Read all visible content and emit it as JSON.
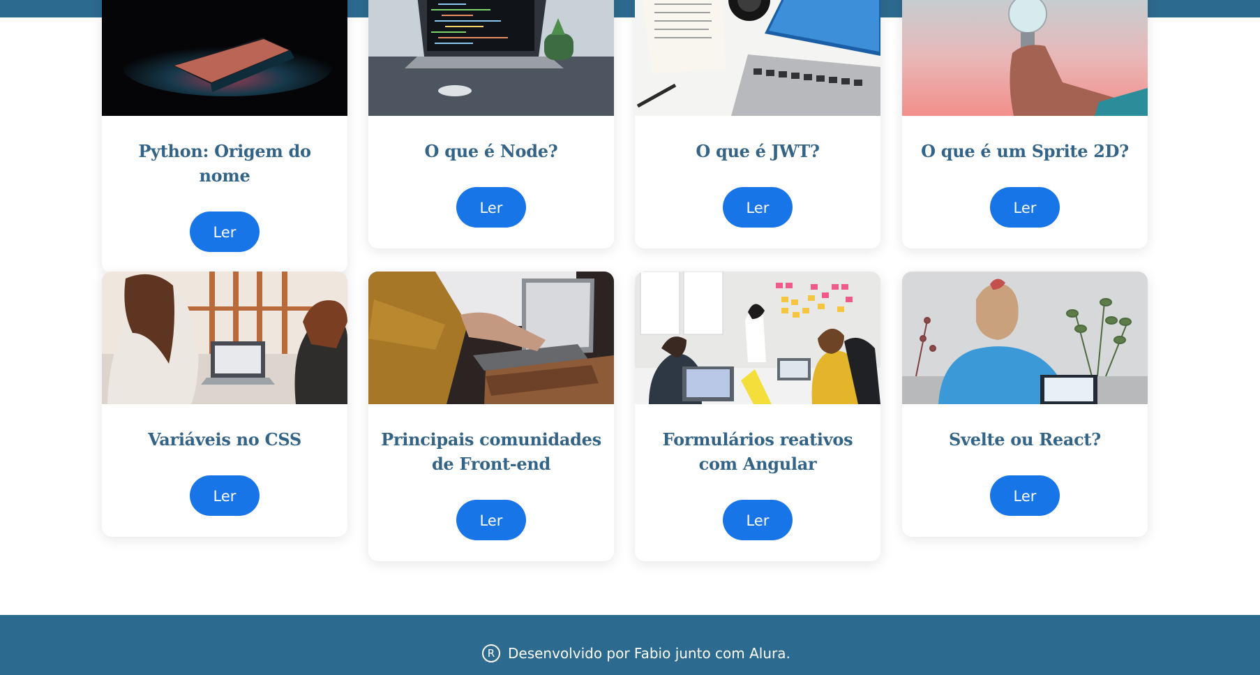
{
  "articles": [
    {
      "title": "Python: Origem do nome",
      "button": "Ler",
      "image": "laptop-dark-glow-photo"
    },
    {
      "title": "O que é Node?",
      "button": "Ler",
      "image": "laptop-code-desk-photo"
    },
    {
      "title": "O que é JWT?",
      "button": "Ler",
      "image": "laptop-notebook-desk-photo"
    },
    {
      "title": "O que é um Sprite 2D?",
      "button": "Ler",
      "image": "lightbulb-hand-photo"
    },
    {
      "title": "Variáveis no CSS",
      "button": "Ler",
      "image": "two-women-laptop-photo"
    },
    {
      "title": "Principais comunidades de Front-end",
      "button": "Ler",
      "image": "typing-laptop-photo"
    },
    {
      "title": "Formulários reativos com Angular",
      "button": "Ler",
      "image": "team-meeting-photo"
    },
    {
      "title": "Svelte ou React?",
      "button": "Ler",
      "image": "woman-laptop-plant-photo"
    }
  ],
  "footer": {
    "icon": "registered-icon",
    "icon_glyph": "R",
    "text": "Desenvolvido por Fabio junto com Alura."
  },
  "colors": {
    "header": "#2d6a8f",
    "footer": "#2d6a8f",
    "title": "#336487",
    "button": "#1875e8"
  }
}
